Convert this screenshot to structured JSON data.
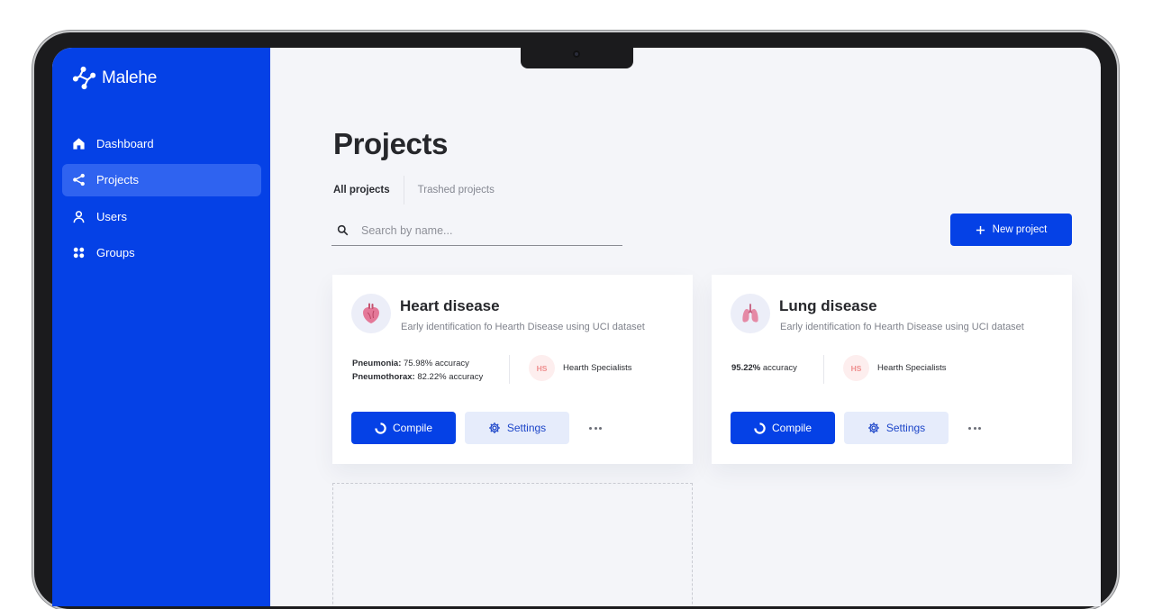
{
  "app": {
    "name": "Malehe"
  },
  "sidebar": {
    "items": [
      {
        "label": "Dashboard",
        "icon": "home-icon",
        "active": false
      },
      {
        "label": "Projects",
        "icon": "share-icon",
        "active": true
      },
      {
        "label": "Users",
        "icon": "user-icon",
        "active": false
      },
      {
        "label": "Groups",
        "icon": "grid-icon",
        "active": false
      }
    ]
  },
  "page": {
    "title": "Projects",
    "tabs": [
      {
        "label": "All projects",
        "active": true
      },
      {
        "label": "Trashed projects",
        "active": false
      }
    ],
    "search": {
      "placeholder": "Search by name..."
    },
    "new_project_label": "New project"
  },
  "projects": [
    {
      "title": "Heart disease",
      "icon": "heart-organ-icon",
      "description": "Early identification fo Hearth Disease using UCI dataset",
      "metrics": [
        {
          "name": "Pneumonia:",
          "value": "75.98% accuracy"
        },
        {
          "name": "Pneumothorax:",
          "value": "82.22% accuracy"
        }
      ],
      "owner": {
        "initials": "HS",
        "name": "Hearth Specialists"
      },
      "compile_label": "Compile",
      "settings_label": "Settings"
    },
    {
      "title": "Lung disease",
      "icon": "lungs-icon",
      "description": "Early identification fo Hearth Disease using UCI dataset",
      "metrics": [
        {
          "name": "95.22%",
          "value": "accuracy"
        }
      ],
      "owner": {
        "initials": "HS",
        "name": "Hearth Specialists"
      },
      "compile_label": "Compile",
      "settings_label": "Settings"
    }
  ],
  "colors": {
    "brand": "#0541e6",
    "sidebar_active": "#2f63f0",
    "avatar_bg": "#fdeeee",
    "avatar_text": "#ef8f8f"
  }
}
